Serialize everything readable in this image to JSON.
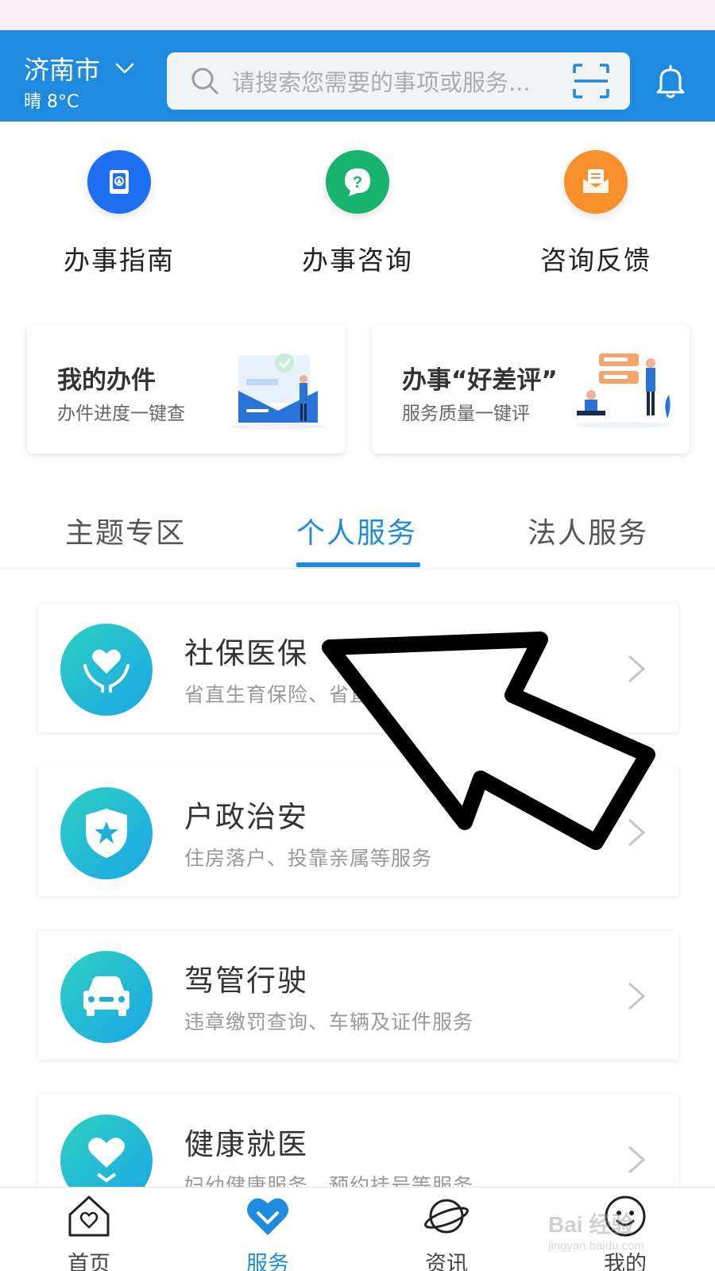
{
  "header": {
    "city": "济南市",
    "weather": "晴 8°C",
    "search_placeholder": "请搜索您需要的事项或服务...",
    "icons": [
      "chevron-down-icon",
      "search-icon",
      "scan-icon",
      "bell-icon"
    ],
    "background_color": "#1e8be0"
  },
  "quick_actions": [
    {
      "label": "办事指南",
      "icon": "guide-book-icon",
      "color": "#1f6ff2"
    },
    {
      "label": "办事咨询",
      "icon": "question-chat-icon",
      "color": "#18b36f"
    },
    {
      "label": "咨询反馈",
      "icon": "mail-feedback-icon",
      "color": "#f7902a"
    }
  ],
  "cards": [
    {
      "title": "我的办件",
      "subtitle": "办件进度一键查",
      "icon": "documents-illustration"
    },
    {
      "title": "办事“好差评”",
      "subtitle": "服务质量一键评",
      "icon": "rating-illustration"
    }
  ],
  "tabs": {
    "items": [
      "主题专区",
      "个人服务",
      "法人服务"
    ],
    "active": "个人服务",
    "accent_color": "#1e8be0"
  },
  "services": [
    {
      "title": "社保医保",
      "subtitle": "省直生育保险、省直养老保险等服务",
      "icon": "hands-heart-icon"
    },
    {
      "title": "户政治安",
      "subtitle": "住房落户、投靠亲属等服务",
      "icon": "shield-star-icon"
    },
    {
      "title": "驾管行驶",
      "subtitle": "违章缴罚查询、车辆及证件服务",
      "icon": "car-icon"
    },
    {
      "title": "健康就医",
      "subtitle": "妇幼健康服务、预约挂号等服务",
      "icon": "heart-hands-icon"
    }
  ],
  "bottom_nav": {
    "items": [
      {
        "label": "首页",
        "icon": "home-heart-icon"
      },
      {
        "label": "服务",
        "icon": "heart-service-icon"
      },
      {
        "label": "资讯",
        "icon": "planet-icon"
      },
      {
        "label": "我的",
        "icon": "smiley-face-icon"
      }
    ],
    "active": "服务"
  },
  "watermark": {
    "text": "Bai 经验",
    "sub": "jingyan.baidu.com"
  }
}
